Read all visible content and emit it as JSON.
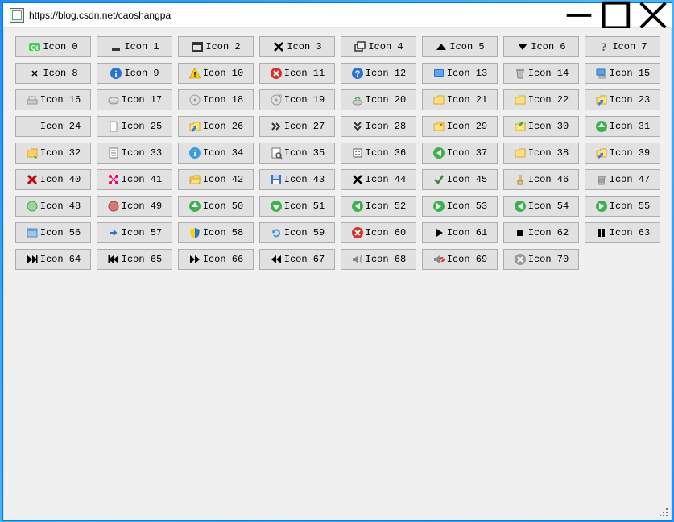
{
  "window": {
    "title": "https://blog.csdn.net/caoshangpa"
  },
  "icons": [
    {
      "label": "Icon 0",
      "name": "qt-logo-icon"
    },
    {
      "label": "Icon 1",
      "name": "title-bar-min-icon"
    },
    {
      "label": "Icon 2",
      "name": "title-bar-normal-icon"
    },
    {
      "label": "Icon 3",
      "name": "title-bar-close-icon"
    },
    {
      "label": "Icon 4",
      "name": "title-bar-max-icon"
    },
    {
      "label": "Icon 5",
      "name": "arrow-up-filled-icon"
    },
    {
      "label": "Icon 6",
      "name": "arrow-down-filled-icon"
    },
    {
      "label": "Icon 7",
      "name": "messagebox-question-icon"
    },
    {
      "label": "Icon 8",
      "name": "title-bar-close-small-icon"
    },
    {
      "label": "Icon 9",
      "name": "messagebox-information-icon"
    },
    {
      "label": "Icon 10",
      "name": "messagebox-warning-icon"
    },
    {
      "label": "Icon 11",
      "name": "messagebox-critical-icon"
    },
    {
      "label": "Icon 12",
      "name": "messagebox-question-blue-icon"
    },
    {
      "label": "Icon 13",
      "name": "desktop-icon"
    },
    {
      "label": "Icon 14",
      "name": "trashcan-icon"
    },
    {
      "label": "Icon 15",
      "name": "computer-icon"
    },
    {
      "label": "Icon 16",
      "name": "drive-floppy-icon"
    },
    {
      "label": "Icon 17",
      "name": "drive-harddisk-icon"
    },
    {
      "label": "Icon 18",
      "name": "drive-cdrom-icon"
    },
    {
      "label": "Icon 19",
      "name": "drive-dvd-icon"
    },
    {
      "label": "Icon 20",
      "name": "drive-network-icon"
    },
    {
      "label": "Icon 21",
      "name": "folder-open-icon"
    },
    {
      "label": "Icon 22",
      "name": "folder-closed-icon"
    },
    {
      "label": "Icon 23",
      "name": "folder-link-icon"
    },
    {
      "label": "Icon 24",
      "name": "file-blank-icon"
    },
    {
      "label": "Icon 25",
      "name": "file-icon"
    },
    {
      "label": "Icon 26",
      "name": "file-link-icon"
    },
    {
      "label": "Icon 27",
      "name": "chevron-right-double-icon"
    },
    {
      "label": "Icon 28",
      "name": "chevron-down-double-icon"
    },
    {
      "label": "Icon 29",
      "name": "file-dialog-new-folder-icon"
    },
    {
      "label": "Icon 30",
      "name": "file-dialog-parent-icon"
    },
    {
      "label": "Icon 31",
      "name": "arrow-up-green-icon"
    },
    {
      "label": "Icon 32",
      "name": "file-dialog-detail-icon"
    },
    {
      "label": "Icon 33",
      "name": "file-dialog-list-icon"
    },
    {
      "label": "Icon 34",
      "name": "file-dialog-info-icon"
    },
    {
      "label": "Icon 35",
      "name": "file-dialog-contents-icon"
    },
    {
      "label": "Icon 36",
      "name": "dir-home-icon"
    },
    {
      "label": "Icon 37",
      "name": "arrow-back-green-icon"
    },
    {
      "label": "Icon 38",
      "name": "folder-icon"
    },
    {
      "label": "Icon 39",
      "name": "link-icon"
    },
    {
      "label": "Icon 40",
      "name": "dialog-cancel-red-icon"
    },
    {
      "label": "Icon 41",
      "name": "fullscreen-icon"
    },
    {
      "label": "Icon 42",
      "name": "folder-open-yellow-icon"
    },
    {
      "label": "Icon 43",
      "name": "dialog-save-icon"
    },
    {
      "label": "Icon 44",
      "name": "dialog-close-icon"
    },
    {
      "label": "Icon 45",
      "name": "dialog-apply-icon"
    },
    {
      "label": "Icon 46",
      "name": "dialog-reset-icon"
    },
    {
      "label": "Icon 47",
      "name": "dialog-discard-icon"
    },
    {
      "label": "Icon 48",
      "name": "dialog-yes-icon"
    },
    {
      "label": "Icon 49",
      "name": "dialog-no-icon"
    },
    {
      "label": "Icon 50",
      "name": "arrow-up-circle-green-icon"
    },
    {
      "label": "Icon 51",
      "name": "arrow-down-circle-green-icon"
    },
    {
      "label": "Icon 52",
      "name": "arrow-left-circle-green-icon"
    },
    {
      "label": "Icon 53",
      "name": "arrow-right-circle-green-icon"
    },
    {
      "label": "Icon 54",
      "name": "arrow-back-circle-icon"
    },
    {
      "label": "Icon 55",
      "name": "arrow-forward-circle-icon"
    },
    {
      "label": "Icon 56",
      "name": "window-icon"
    },
    {
      "label": "Icon 57",
      "name": "commandlink-arrow-icon"
    },
    {
      "label": "Icon 58",
      "name": "shield-icon"
    },
    {
      "label": "Icon 59",
      "name": "browser-reload-icon"
    },
    {
      "label": "Icon 60",
      "name": "browser-stop-icon"
    },
    {
      "label": "Icon 61",
      "name": "media-play-icon"
    },
    {
      "label": "Icon 62",
      "name": "media-stop-icon"
    },
    {
      "label": "Icon 63",
      "name": "media-pause-icon"
    },
    {
      "label": "Icon 64",
      "name": "media-skip-forward-icon"
    },
    {
      "label": "Icon 65",
      "name": "media-skip-backward-icon"
    },
    {
      "label": "Icon 66",
      "name": "media-seek-forward-icon"
    },
    {
      "label": "Icon 67",
      "name": "media-seek-backward-icon"
    },
    {
      "label": "Icon 68",
      "name": "media-volume-icon"
    },
    {
      "label": "Icon 69",
      "name": "media-volume-muted-icon"
    },
    {
      "label": "Icon 70",
      "name": "close-grey-circle-icon"
    }
  ]
}
